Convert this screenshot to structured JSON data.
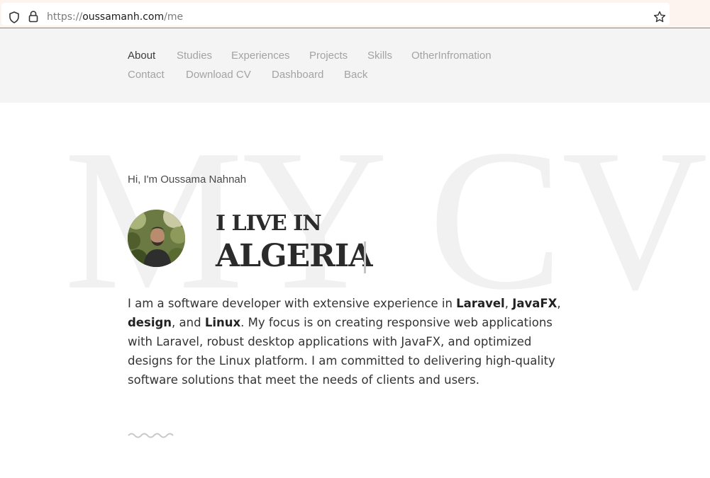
{
  "browser": {
    "url_scheme": "https://",
    "url_host": "oussamanh.com",
    "url_path": "/me"
  },
  "nav": {
    "items": [
      {
        "label": "About",
        "active": true
      },
      {
        "label": "Studies"
      },
      {
        "label": "Experiences"
      },
      {
        "label": "Projects"
      },
      {
        "label": "Skills"
      },
      {
        "label": "OtherInfromation"
      },
      {
        "label": "Contact"
      },
      {
        "label": "Download CV"
      },
      {
        "label": "Dashboard"
      },
      {
        "label": "Back"
      }
    ]
  },
  "hero": {
    "background_text": "MY CV",
    "greeting": "Hi, I'm Oussama Nahnah",
    "live_prefix": "I LIVE IN",
    "country": "ALGERIA"
  },
  "about": {
    "t1": "I am a software developer with extensive experience in ",
    "b1": "Laravel",
    "t2": ", ",
    "b2": "JavaFX",
    "t3": ", ",
    "b3": "design",
    "t4": ", and ",
    "b4": "Linux",
    "t5": ". My focus is on creating responsive web applications with Laravel, robust desktop applications with JavaFX, and optimized designs for the Linux platform. I am committed to delivering high-quality software solutions that meet the needs of clients and users."
  },
  "icons": [
    "shield-icon",
    "lock-icon",
    "star-icon",
    "wave-divider"
  ]
}
